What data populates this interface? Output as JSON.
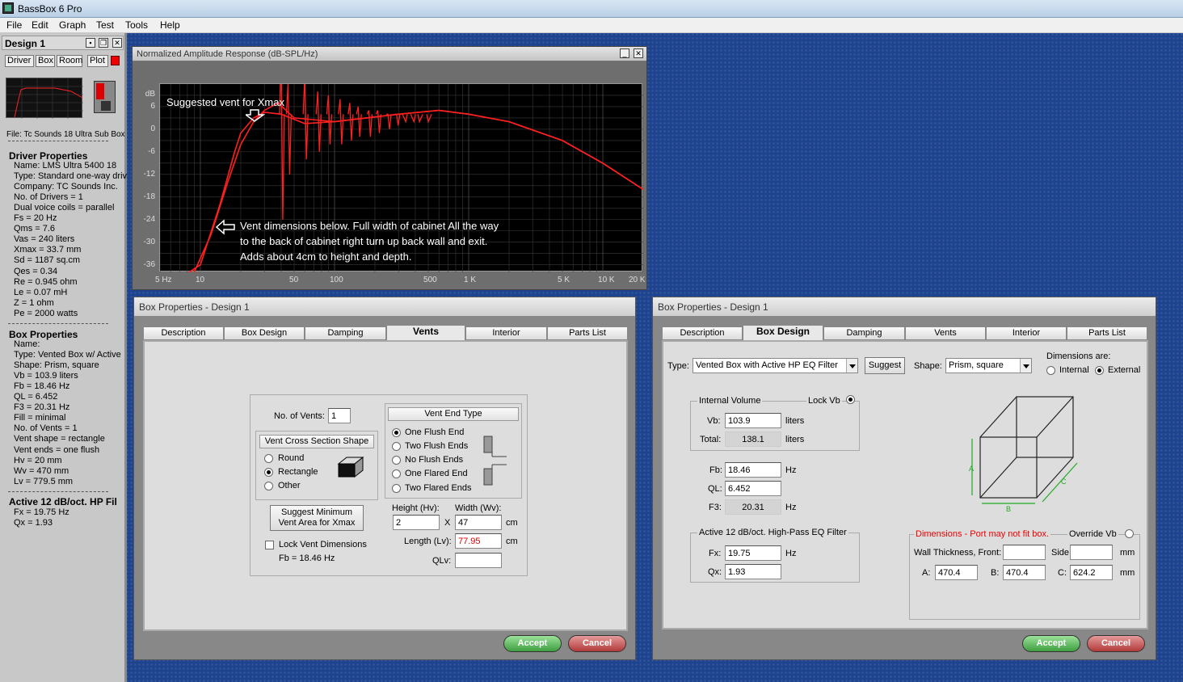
{
  "app": {
    "title": "BassBox 6 Pro"
  },
  "menu": [
    "File",
    "Edit",
    "Graph",
    "Test",
    "Tools",
    "Help"
  ],
  "design_panel": {
    "title": "Design 1",
    "tabs": [
      "Driver",
      "Box",
      "Room",
      "Plot"
    ],
    "file": "File: Tc Sounds 18 Ultra Sub Box",
    "driver_heading": "Driver Properties",
    "driver_lines": [
      "Name: LMS Ultra 5400 18",
      "Type: Standard one-way driv",
      "Company: TC Sounds Inc.",
      "No. of Drivers = 1",
      "Dual voice coils = parallel",
      "Fs =  20 Hz",
      "Qms =  7.6",
      "Vas =  240 liters",
      "Xmax =  33.7 mm",
      "Sd =  1187 sq.cm",
      "Qes =  0.34",
      "Re =  0.945 ohm",
      "Le =  0.07 mH",
      "Z =  1 ohm",
      "Pe =  2000 watts"
    ],
    "box_heading": "Box Properties",
    "box_lines": [
      "Name:",
      "Type: Vented Box w/ Active",
      "Shape: Prism, square",
      "Vb =  103.9 liters",
      "Fb =  18.46 Hz",
      "QL =  6.452",
      "F3 =  20.31 Hz",
      "Fill = minimal",
      "No. of Vents = 1",
      "Vent shape = rectangle",
      "Vent ends = one flush",
      "Hv =  20 mm",
      "Wv =  470 mm",
      "Lv =  779.5 mm"
    ],
    "active_heading": "Active 12 dB/oct. HP Fil",
    "active_lines": [
      "Fx =  19.75 Hz",
      "Qx =  1.93"
    ]
  },
  "chart_window": {
    "title": "Normalized Amplitude Response (dB-SPL/Hz)",
    "annotation_top": "Suggested vent for Xmax",
    "annotation_bottom": [
      "Vent dimensions below. Full width of cabinet All the way",
      "to the back of cabinet right turn up back wall and exit.",
      "Adds about 4cm to height and depth."
    ]
  },
  "chart_data": {
    "type": "line",
    "ylabel": "dB",
    "y_ticks": [
      "6",
      "0",
      "-6",
      "-12",
      "-18",
      "-24",
      "-30",
      "-36"
    ],
    "x_ticks": [
      "5 Hz",
      "10",
      "50",
      "100",
      "500",
      "1 K",
      "5 K",
      "10 K",
      "20 K"
    ],
    "x_scale": "log",
    "xlim": [
      5,
      20000
    ],
    "ylim": [
      -38,
      12
    ],
    "grid": true,
    "series": [
      {
        "x": [
          5,
          10,
          14,
          18,
          20,
          25,
          30,
          40,
          60,
          100,
          300,
          600,
          1000,
          2000,
          5000,
          10000,
          20000
        ],
        "y": [
          -60,
          -36,
          -20,
          -6,
          -1,
          3,
          4.5,
          4,
          1.5,
          2,
          4,
          5,
          4,
          2,
          -3,
          -9,
          -16
        ],
        "color": "#ff2020"
      },
      {
        "x": [
          5,
          8,
          12,
          16,
          20,
          25,
          30,
          38,
          50,
          100,
          300,
          600,
          1000,
          2000,
          5000,
          10000,
          20000
        ],
        "y": [
          -60,
          -42,
          -28,
          -14,
          -4,
          2,
          5,
          7,
          3,
          2,
          4,
          5,
          4,
          2,
          -3,
          -9,
          -16
        ],
        "color": "#ff2020"
      }
    ]
  },
  "box_vents": {
    "title": "Box Properties - Design 1",
    "tabs": [
      "Description",
      "Box Design",
      "Damping",
      "Vents",
      "Interior",
      "Parts List"
    ],
    "active_tab": "Vents",
    "no_vents_label": "No. of Vents:",
    "no_vents": "1",
    "shape_header": "Vent Cross Section Shape",
    "shapes": [
      "Round",
      "Rectangle",
      "Other"
    ],
    "end_header": "Vent End Type",
    "ends": [
      "One Flush End",
      "Two Flush Ends",
      "No Flush Ends",
      "One Flared End",
      "Two Flared Ends"
    ],
    "suggest": "Suggest Minimum\nVent Area for Xmax",
    "lock_label": "Lock Vent Dimensions",
    "fb_text": "Fb = 18.46 Hz",
    "height_label": "Height (Hv):",
    "width_label": "Width (Wv):",
    "x_label": "X",
    "height": "2",
    "width": "47",
    "cm1": "cm",
    "length_label": "Length (Lv):",
    "length": "77.95",
    "cm2": "cm",
    "qlv_label": "QLv:",
    "accept": "Accept",
    "cancel": "Cancel"
  },
  "box_design": {
    "title": "Box Properties - Design 1",
    "tabs": [
      "Description",
      "Box Design",
      "Damping",
      "Vents",
      "Interior",
      "Parts List"
    ],
    "active_tab": "Box Design",
    "type_label": "Type:",
    "type_value": "Vented Box with Active HP EQ Filter",
    "suggest": "Suggest",
    "shape_label": "Shape:",
    "shape_value": "Prism, square",
    "dims_label": "Dimensions are:",
    "internal": "Internal",
    "external": "External",
    "iv_label": "Internal Volume",
    "lock_vb": "Lock Vb",
    "vb_label": "Vb:",
    "vb": "103.9",
    "liters1": "liters",
    "total_label": "Total:",
    "total": "138.1",
    "liters2": "liters",
    "fb_label": "Fb:",
    "fb": "18.46",
    "hz1": "Hz",
    "ql_label": "QL:",
    "ql": "6.452",
    "f3_label": "F3:",
    "f3": "20.31",
    "hz2": "Hz",
    "hp_header": "Active 12 dB/oct. High-Pass EQ Filter",
    "fx_label": "Fx:",
    "fx": "19.75",
    "hz3": "Hz",
    "qx_label": "Qx:",
    "qx": "1.93",
    "dims_warn": "Dimensions - Port may not fit box.",
    "override": "Override Vb",
    "wall_label": "Wall Thickness, Front:",
    "side_label": "Side:",
    "mm1": "mm",
    "a_label": "A:",
    "a": "470.4",
    "b_label": "B:",
    "b": "470.4",
    "c_label": "C:",
    "c": "624.2",
    "mm2": "mm",
    "cube_a": "A",
    "cube_b": "B",
    "cube_c": "C",
    "accept": "Accept",
    "cancel": "Cancel"
  }
}
